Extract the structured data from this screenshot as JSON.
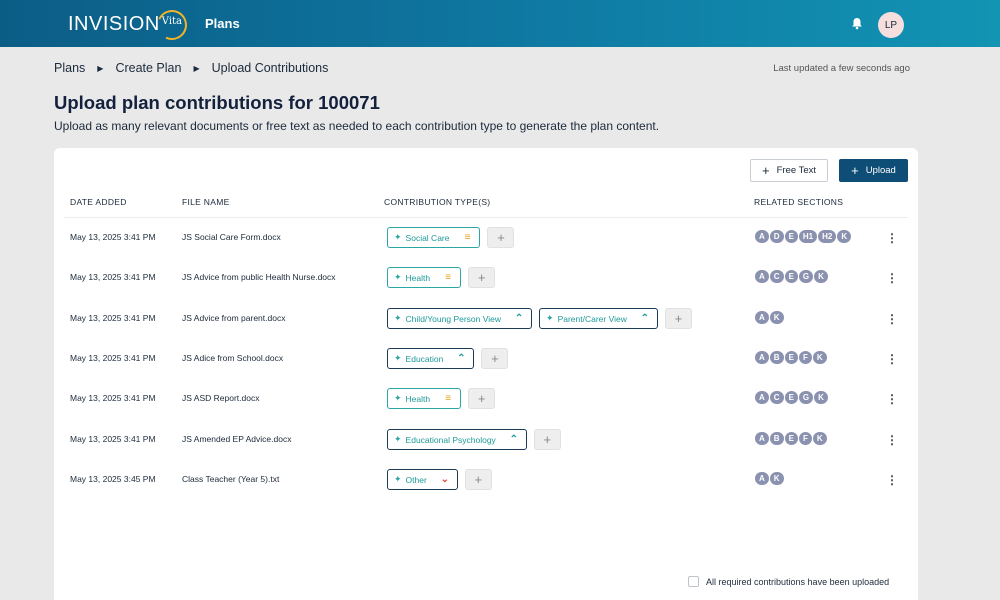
{
  "app": {
    "logo_text": "INVISION",
    "logo_sub": "Vita",
    "nav_plans": "Plans",
    "bell_icon": "bell-icon",
    "avatar_initials": "LP"
  },
  "breadcrumb": [
    "Plans",
    "Create Plan",
    "Upload Contributions"
  ],
  "last_updated": "Last updated a few seconds ago",
  "page": {
    "title": "Upload plan contributions for 100071",
    "subtitle": "Upload as many relevant documents or free text as needed to each contribution type to generate the plan content."
  },
  "toolbar": {
    "free_text_label": "Free Text",
    "upload_label": "Upload"
  },
  "table": {
    "headers": {
      "date": "DATE ADDED",
      "file": "FILE NAME",
      "types": "CONTRIBUTION TYPE(S)",
      "sections": "RELATED SECTIONS"
    },
    "rows": [
      {
        "date": "May 13, 2025 3:41 PM",
        "file": "JS Social Care Form.docx",
        "types": [
          {
            "label": "Social Care",
            "status": "equal"
          }
        ],
        "sections": [
          "A",
          "D",
          "E",
          "H1",
          "H2",
          "K"
        ]
      },
      {
        "date": "May 13, 2025 3:41 PM",
        "file": "JS Advice from public Health Nurse.docx",
        "types": [
          {
            "label": "Health",
            "status": "equal"
          }
        ],
        "sections": [
          "A",
          "C",
          "E",
          "G",
          "K"
        ]
      },
      {
        "date": "May 13, 2025 3:41 PM",
        "file": "JS Advice from parent.docx",
        "types": [
          {
            "label": "Child/Young Person View",
            "status": "up"
          },
          {
            "label": "Parent/Carer View",
            "status": "up"
          }
        ],
        "sections": [
          "A",
          "K"
        ]
      },
      {
        "date": "May 13, 2025 3:41 PM",
        "file": "JS Adice from School.docx",
        "types": [
          {
            "label": "Education",
            "status": "up"
          }
        ],
        "sections": [
          "A",
          "B",
          "E",
          "F",
          "K"
        ]
      },
      {
        "date": "May 13, 2025 3:41 PM",
        "file": "JS ASD Report.docx",
        "types": [
          {
            "label": "Health",
            "status": "equal"
          }
        ],
        "sections": [
          "A",
          "C",
          "E",
          "G",
          "K"
        ]
      },
      {
        "date": "May 13, 2025 3:41 PM",
        "file": "JS Amended EP Advice.docx",
        "types": [
          {
            "label": "Educational Psychology",
            "status": "up"
          }
        ],
        "sections": [
          "A",
          "B",
          "E",
          "F",
          "K"
        ]
      },
      {
        "date": "May 13, 2025 3:45 PM",
        "file": "Class Teacher (Year 5).txt",
        "types": [
          {
            "label": "Other",
            "status": "down"
          }
        ],
        "sections": [
          "A",
          "K"
        ]
      }
    ]
  },
  "footer": {
    "checkbox_label": "All required contributions have been uploaded",
    "checked": false
  },
  "colors": {
    "topbar_start": "#0b5d86",
    "topbar_end": "#1294b3",
    "chip_teal": "#2aa6a6",
    "status_equal": "#e6a21b",
    "status_down": "#e0503a",
    "badge": "#8b92b0",
    "primary_button": "#0e4d76"
  }
}
